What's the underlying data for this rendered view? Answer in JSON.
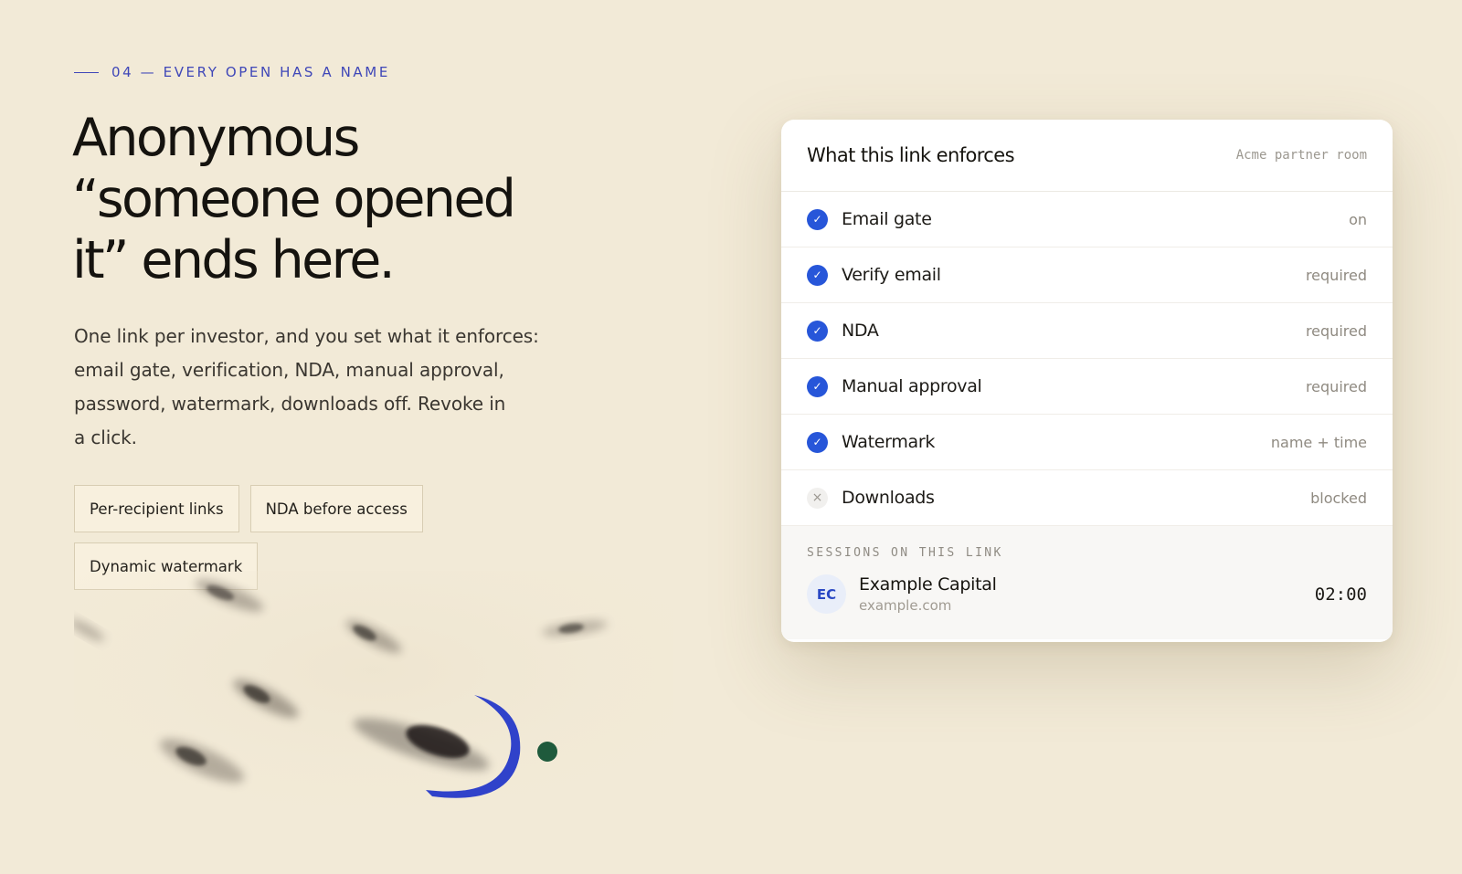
{
  "section": {
    "eyebrow": "04 — EVERY OPEN HAS A NAME",
    "headline_lines": [
      "Anonymous",
      "“someone opened",
      "it” ends here."
    ],
    "lede_lines": [
      "One link per investor, and you set what it enforces:",
      "email gate, verification, NDA, manual approval,",
      "password, watermark, downloads off. Revoke in",
      "a click."
    ],
    "tags": [
      "Per-recipient links",
      "NDA before access",
      "Dynamic watermark"
    ]
  },
  "card": {
    "title": "What this link enforces",
    "room": "Acme partner room",
    "rules": [
      {
        "label": "Email gate",
        "value": "on",
        "enabled": true
      },
      {
        "label": "Verify email",
        "value": "required",
        "enabled": true
      },
      {
        "label": "NDA",
        "value": "required",
        "enabled": true
      },
      {
        "label": "Manual approval",
        "value": "required",
        "enabled": true
      },
      {
        "label": "Watermark",
        "value": "name + time",
        "enabled": true
      },
      {
        "label": "Downloads",
        "value": "blocked",
        "enabled": false
      }
    ],
    "sessions": {
      "title": "SESSIONS ON THIS LINK",
      "items": [
        {
          "initials": "EC",
          "name": "Example Capital",
          "domain": "example.com",
          "time": "02:00"
        }
      ]
    }
  },
  "icons": {
    "enabled": "check-icon",
    "disabled": "close-icon"
  },
  "colors": {
    "background": "#f2ead7",
    "accent": "#2756d9",
    "eyebrow": "#3f47b8",
    "ink_dot": "#1f5a3c"
  }
}
